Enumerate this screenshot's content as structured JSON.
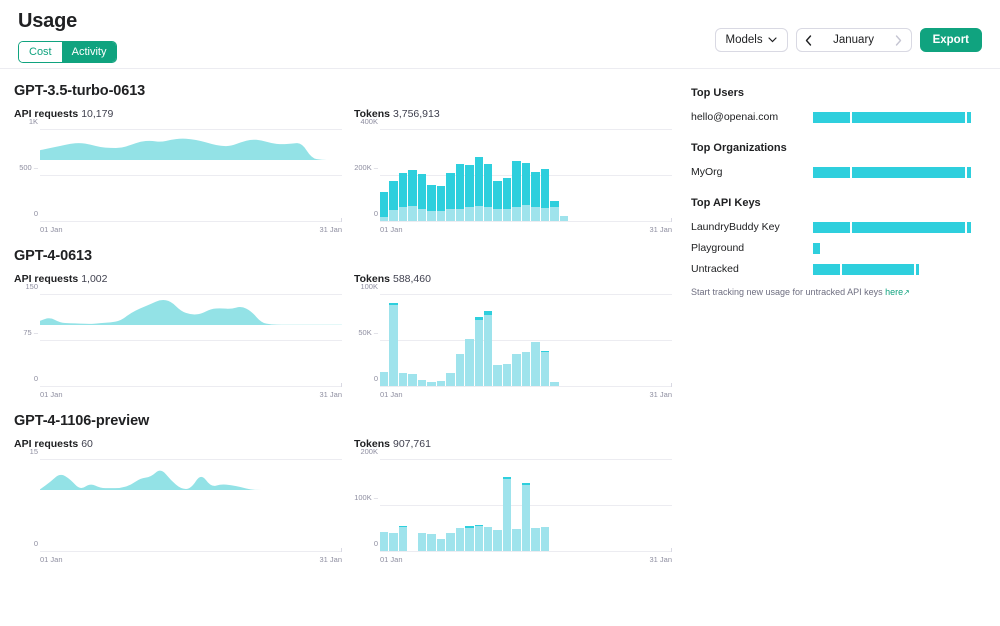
{
  "header": {
    "title": "Usage",
    "toggle": {
      "cost_label": "Cost",
      "activity_label": "Activity",
      "active": "Activity"
    },
    "models_button": "Models",
    "models_caret": "chevron-down-icon",
    "month": "January",
    "prev_arrow": "‹",
    "next_arrow": "›",
    "export_label": "Export"
  },
  "colors": {
    "brand_green": "#10a37f",
    "bar_dark": "#2ecfdd",
    "bar_light": "#9fe3ec",
    "area_fill": "#93e2e6",
    "grid": "#ececf1",
    "muted_text": "#8e8ea0"
  },
  "models": [
    {
      "name": "GPT-3.5-turbo-0613",
      "requests": {
        "label": "API requests",
        "value": "10,179"
      },
      "tokens": {
        "label": "Tokens",
        "value": "3,756,913"
      }
    },
    {
      "name": "GPT-4-0613",
      "requests": {
        "label": "API requests",
        "value": "1,002"
      },
      "tokens": {
        "label": "Tokens",
        "value": "588,460"
      }
    },
    {
      "name": "GPT-4-1106-preview",
      "requests": {
        "label": "API requests",
        "value": "60"
      },
      "tokens": {
        "label": "Tokens",
        "value": "907,761"
      }
    }
  ],
  "sidebar": {
    "top_users": {
      "heading": "Top Users",
      "rows": [
        {
          "label": "hello@openai.com",
          "segments": [
            22,
            68,
            2
          ]
        }
      ]
    },
    "top_orgs": {
      "heading": "Top Organizations",
      "rows": [
        {
          "label": "MyOrg",
          "segments": [
            22,
            68,
            2
          ]
        }
      ]
    },
    "top_keys": {
      "heading": "Top API Keys",
      "rows": [
        {
          "label": "LaundryBuddy Key",
          "segments": [
            22,
            68,
            2
          ]
        },
        {
          "label": "Playground",
          "segments": [
            4
          ]
        },
        {
          "label": "Untracked",
          "segments": [
            16,
            43,
            2
          ]
        }
      ]
    },
    "note_text": "Start tracking new usage for untracked API keys",
    "note_link": "here",
    "note_link_icon": "external-link-icon"
  },
  "chart_data": [
    {
      "type": "area",
      "title": "GPT-3.5-turbo-0613 — API requests",
      "ylabel": "",
      "xlabel": "",
      "ylim": [
        0,
        1000
      ],
      "yticks": [
        0,
        500,
        1000
      ],
      "ytick_labels": [
        "0",
        "500",
        "1K"
      ],
      "x": [
        "01 Jan",
        "31 Jan"
      ],
      "xtick_labels": [
        "01 Jan",
        "31 Jan"
      ],
      "grid": true,
      "values": [
        330,
        400,
        470,
        545,
        575,
        520,
        430,
        405,
        400,
        500,
        620,
        650,
        600,
        675,
        720,
        700,
        640,
        540,
        465,
        470,
        600,
        690,
        660,
        560,
        525,
        545,
        585,
        60,
        8,
        6,
        6
      ]
    },
    {
      "type": "bar",
      "title": "GPT-3.5-turbo-0613 — Tokens",
      "ylim": [
        0,
        400000
      ],
      "yticks": [
        0,
        200000,
        400000
      ],
      "ytick_labels": [
        "0",
        "200K",
        "400K"
      ],
      "xtick_labels": [
        "01 Jan",
        "31 Jan"
      ],
      "grid": true,
      "stacked": true,
      "series": [
        {
          "name": "lower",
          "values": [
            18000,
            48000,
            60000,
            65000,
            55000,
            42000,
            42000,
            52000,
            55000,
            62000,
            68000,
            60000,
            52000,
            55000,
            62000,
            70000,
            62000,
            58000,
            62000,
            24000,
            0,
            0,
            0,
            0,
            0,
            0,
            0,
            0,
            0,
            0,
            0
          ]
        },
        {
          "name": "upper",
          "values": [
            108000,
            128000,
            150000,
            160000,
            150000,
            118000,
            112000,
            158000,
            195000,
            185000,
            215000,
            192000,
            122000,
            132000,
            200000,
            185000,
            152000,
            172000,
            28000,
            0,
            0,
            0,
            0,
            0,
            0,
            0,
            0,
            0,
            0,
            0,
            0
          ]
        }
      ]
    },
    {
      "type": "area",
      "title": "GPT-4-0613 — API requests",
      "ylim": [
        0,
        150
      ],
      "yticks": [
        0,
        75,
        150
      ],
      "ytick_labels": [
        "0",
        "75",
        "150"
      ],
      "xtick_labels": [
        "01 Jan",
        "31 Jan"
      ],
      "grid": true,
      "values": [
        22,
        40,
        12,
        10,
        8,
        6,
        10,
        14,
        22,
        60,
        85,
        105,
        128,
        120,
        70,
        52,
        55,
        82,
        84,
        80,
        95,
        70,
        12,
        3,
        2,
        2,
        2,
        2,
        2,
        2,
        2
      ]
    },
    {
      "type": "bar",
      "title": "GPT-4-0613 — Tokens",
      "ylim": [
        0,
        100000
      ],
      "yticks": [
        0,
        50000,
        100000
      ],
      "ytick_labels": [
        "0",
        "50K",
        "100K"
      ],
      "xtick_labels": [
        "01 Jan",
        "31 Jan"
      ],
      "grid": true,
      "stacked": true,
      "series": [
        {
          "name": "lower",
          "values": [
            15000,
            89000,
            14000,
            13000,
            7000,
            4000,
            6000,
            14000,
            35000,
            52000,
            73000,
            78000,
            23000,
            24000,
            35000,
            37000,
            48000,
            37000,
            4000,
            0,
            0,
            0,
            0,
            0,
            0,
            0,
            0,
            0,
            0,
            0,
            0
          ]
        },
        {
          "name": "upper",
          "values": [
            0,
            2500,
            0,
            0,
            0,
            0,
            0,
            0,
            0,
            0,
            3000,
            4000,
            0,
            0,
            0,
            0,
            0,
            2000,
            0,
            0,
            0,
            0,
            0,
            0,
            0,
            0,
            0,
            0,
            0,
            0,
            0
          ]
        }
      ]
    },
    {
      "type": "area",
      "title": "GPT-4-1106-preview — API requests",
      "ylim": [
        0,
        15
      ],
      "yticks": [
        0,
        15
      ],
      "ytick_labels": [
        "0",
        "15"
      ],
      "xtick_labels": [
        "01 Jan",
        "31 Jan"
      ],
      "grid": true,
      "values": [
        0.4,
        4,
        8.5,
        5.5,
        0,
        3.5,
        1,
        1,
        1,
        2.5,
        6,
        6.5,
        11,
        5,
        0.6,
        0.6,
        8.5,
        1.5,
        3,
        2.5,
        1.5,
        0.2,
        0.1,
        0.1,
        0.1,
        0.1,
        0.1,
        0.1,
        0.1,
        0.1,
        0.1
      ]
    },
    {
      "type": "bar",
      "title": "GPT-4-1106-preview — Tokens",
      "ylim": [
        0,
        200000
      ],
      "yticks": [
        0,
        100000,
        200000
      ],
      "ytick_labels": [
        "0",
        "100K",
        "200K"
      ],
      "xtick_labels": [
        "01 Jan",
        "31 Jan"
      ],
      "grid": true,
      "stacked": true,
      "series": [
        {
          "name": "lower",
          "values": [
            42000,
            40000,
            52000,
            0,
            39000,
            38000,
            27000,
            40000,
            50000,
            50000,
            56000,
            52000,
            46000,
            158000,
            48000,
            146000,
            50000,
            52000,
            0,
            0,
            0,
            0,
            0,
            0,
            0,
            0,
            0,
            0,
            0,
            0,
            0
          ]
        },
        {
          "name": "upper",
          "values": [
            0,
            0,
            2000,
            0,
            0,
            0,
            0,
            0,
            0,
            4000,
            2000,
            0,
            0,
            4000,
            0,
            3000,
            0,
            0,
            0,
            0,
            0,
            0,
            0,
            0,
            0,
            0,
            0,
            0,
            0,
            0,
            0
          ]
        }
      ]
    }
  ]
}
